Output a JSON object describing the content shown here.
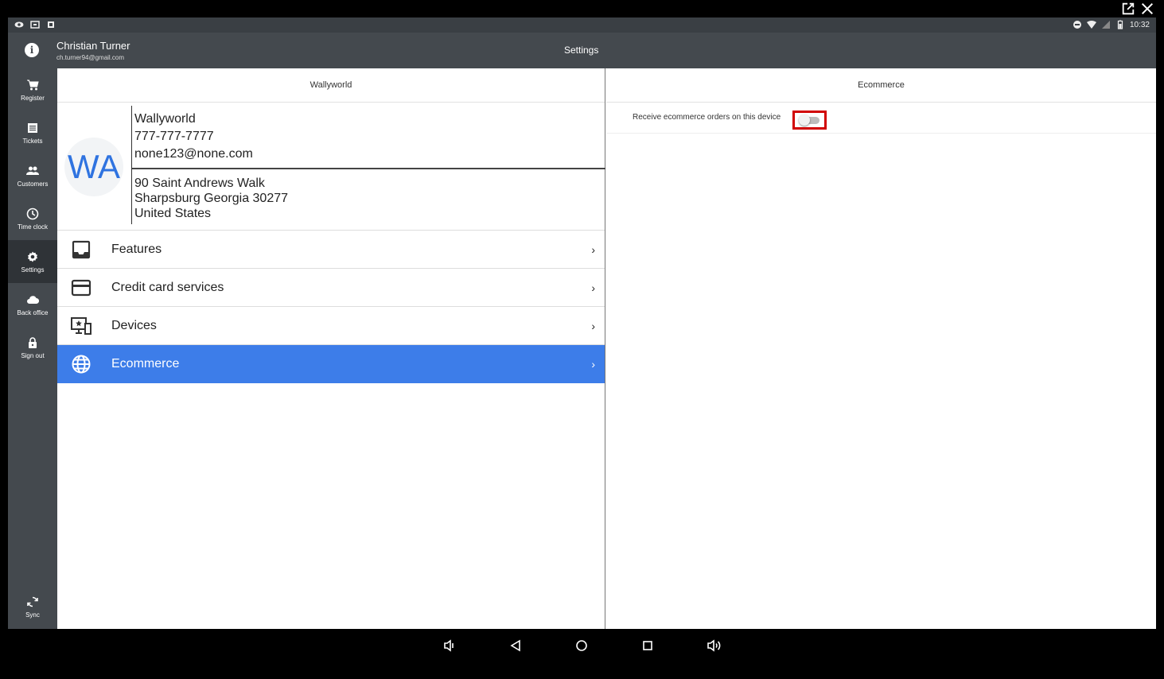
{
  "statusbar": {
    "time": "10:32"
  },
  "appbar": {
    "user_name": "Christian Turner",
    "user_email": "ch.turner94@gmail.com",
    "title": "Settings",
    "info_glyph": "i"
  },
  "sidebar": {
    "items": [
      {
        "label": "Register",
        "icon": "cart-icon"
      },
      {
        "label": "Tickets",
        "icon": "list-icon"
      },
      {
        "label": "Customers",
        "icon": "people-icon"
      },
      {
        "label": "Time clock",
        "icon": "clock-icon"
      },
      {
        "label": "Settings",
        "icon": "gear-icon",
        "active": true
      },
      {
        "label": "Back office",
        "icon": "cloud-icon"
      },
      {
        "label": "Sign out",
        "icon": "lock-icon"
      }
    ],
    "sync": {
      "label": "Sync",
      "icon": "sync-icon"
    }
  },
  "left_panel": {
    "header": "Wallyworld",
    "business": {
      "initials": "WA",
      "name": "Wallyworld",
      "phone": "777-777-7777",
      "email": "none123@none.com",
      "address_line1": "90 Saint Andrews Walk",
      "address_line2": "Sharpsburg Georgia 30277",
      "country": "United States"
    },
    "menu": [
      {
        "label": "Features",
        "icon": "inbox-icon"
      },
      {
        "label": "Credit card services",
        "icon": "credit-card-icon"
      },
      {
        "label": "Devices",
        "icon": "devices-icon"
      },
      {
        "label": "Ecommerce",
        "icon": "globe-icon",
        "active": true
      }
    ],
    "chevron": "›"
  },
  "right_panel": {
    "header": "Ecommerce",
    "setting": {
      "label": "Receive ecommerce orders on this device",
      "enabled": false
    }
  },
  "colors": {
    "accent": "#3d7de9",
    "appbar": "#44494e",
    "highlight_box": "#d10000"
  }
}
